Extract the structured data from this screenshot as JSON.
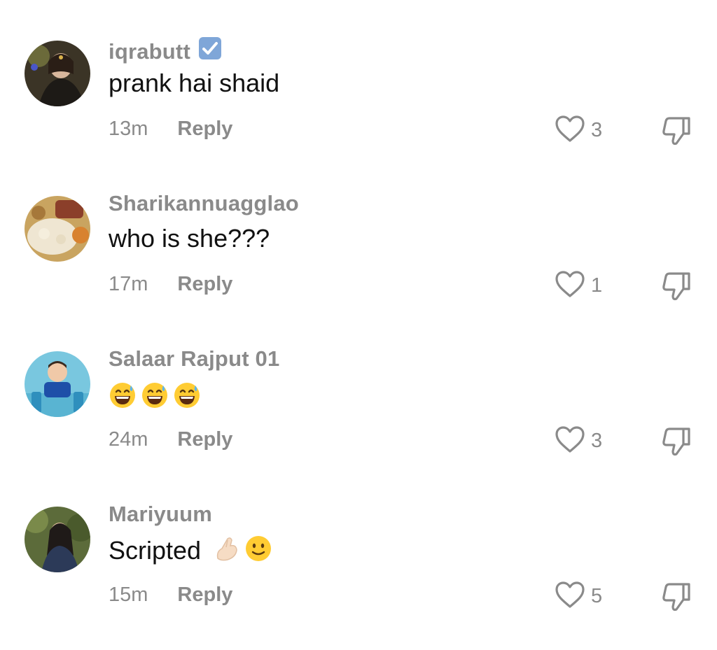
{
  "comments": [
    {
      "username": "iqrabutt",
      "verified_icon": "check-box-emoji",
      "text": "prank hai shaid",
      "time": "13m",
      "reply_label": "Reply",
      "likes": "3"
    },
    {
      "username": "Sharikannuagglao",
      "text": "who is she???",
      "time": "17m",
      "reply_label": "Reply",
      "likes": "1"
    },
    {
      "username": "Salaar Rajput 01",
      "emojis": [
        "grinning-sweat-emoji",
        "grinning-sweat-emoji",
        "grinning-sweat-emoji"
      ],
      "time": "24m",
      "reply_label": "Reply",
      "likes": "3"
    },
    {
      "username": "Mariyuum",
      "text": "Scripted",
      "emojis": [
        "pinched-fingers-emoji",
        "slightly-smiling-emoji"
      ],
      "time": "15m",
      "reply_label": "Reply",
      "likes": "5"
    }
  ],
  "colors": {
    "muted_text": "#8a8a8a",
    "body_text": "#111111",
    "verified_blue": "#5b9bd5",
    "emoji_yellow": "#ffcc33"
  }
}
